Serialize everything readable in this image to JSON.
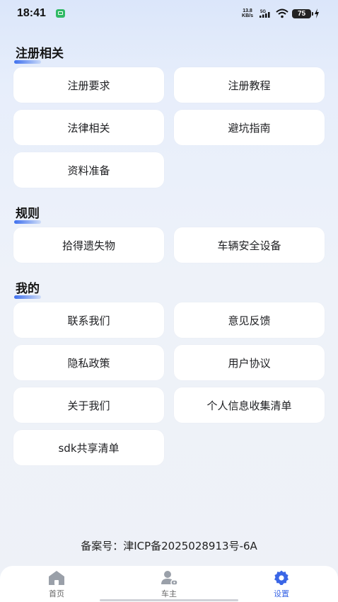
{
  "status_bar": {
    "time": "18:41",
    "net_speed_value": "13.8",
    "net_speed_unit": "KB/s",
    "network": "5G",
    "battery": "75"
  },
  "sections": [
    {
      "title": "注册相关",
      "items": [
        "注册要求",
        "注册教程",
        "法律相关",
        "避坑指南",
        "资料准备"
      ]
    },
    {
      "title": "规则",
      "items": [
        "拾得遗失物",
        "车辆安全设备"
      ]
    },
    {
      "title": "我的",
      "items": [
        "联系我们",
        "意见反馈",
        "隐私政策",
        "用户协议",
        "关于我们",
        "个人信息收集清单",
        "sdk共享清单"
      ]
    }
  ],
  "icp": "备案号：津ICP备2025028913号-6A",
  "tabs": [
    {
      "label": "首页",
      "icon": "home-icon",
      "active": false
    },
    {
      "label": "车主",
      "icon": "owner-icon",
      "active": false
    },
    {
      "label": "设置",
      "icon": "settings-gear-icon",
      "active": true
    }
  ],
  "colors": {
    "accent": "#3a66e6",
    "card": "#ffffff",
    "background": "#eef1f7"
  }
}
